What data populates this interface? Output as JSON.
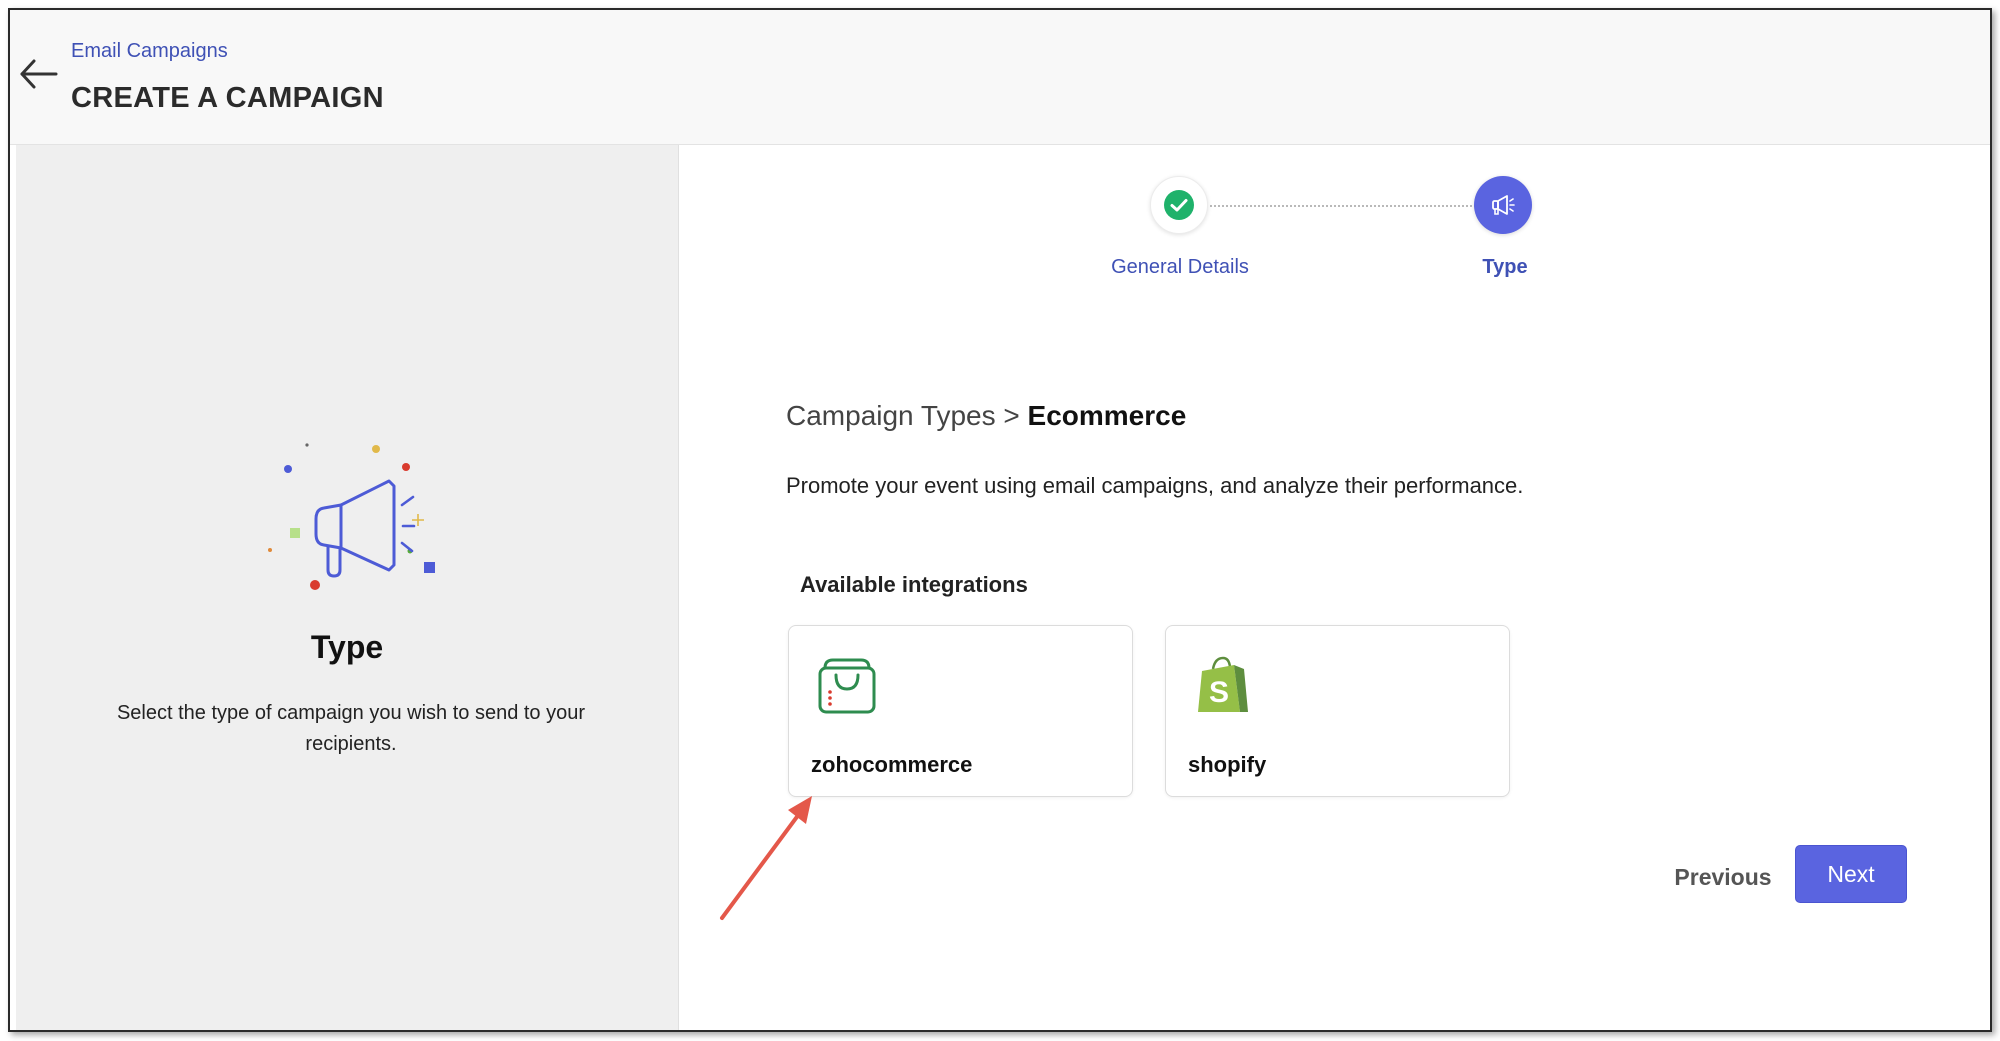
{
  "header": {
    "breadcrumb": "Email Campaigns",
    "title": "CREATE A CAMPAIGN",
    "back_icon": "arrow-left-icon"
  },
  "left_panel": {
    "illustration_icon": "megaphone-icon",
    "title": "Type",
    "description": "Select the type of campaign you wish to send to your recipients."
  },
  "stepper": {
    "steps": [
      {
        "label": "General Details",
        "status": "completed",
        "icon": "check-icon"
      },
      {
        "label": "Type",
        "status": "active",
        "icon": "megaphone-icon"
      }
    ]
  },
  "main": {
    "crumb_prefix": "Campaign Types",
    "crumb_separator": ">",
    "crumb_current": "Ecommerce",
    "description": "Promote your event using email campaigns, and analyze their performance.",
    "integrations_heading": "Available integrations",
    "integrations": [
      {
        "name": "zohocommerce",
        "icon": "zohocommerce-bag-icon"
      },
      {
        "name": "shopify",
        "icon": "shopify-bag-icon"
      }
    ]
  },
  "buttons": {
    "previous": "Previous",
    "next": "Next"
  },
  "colors": {
    "accent": "#5a64e0",
    "link": "#3f51b5",
    "success": "#1fb26b",
    "annotation": "#e4584a"
  }
}
